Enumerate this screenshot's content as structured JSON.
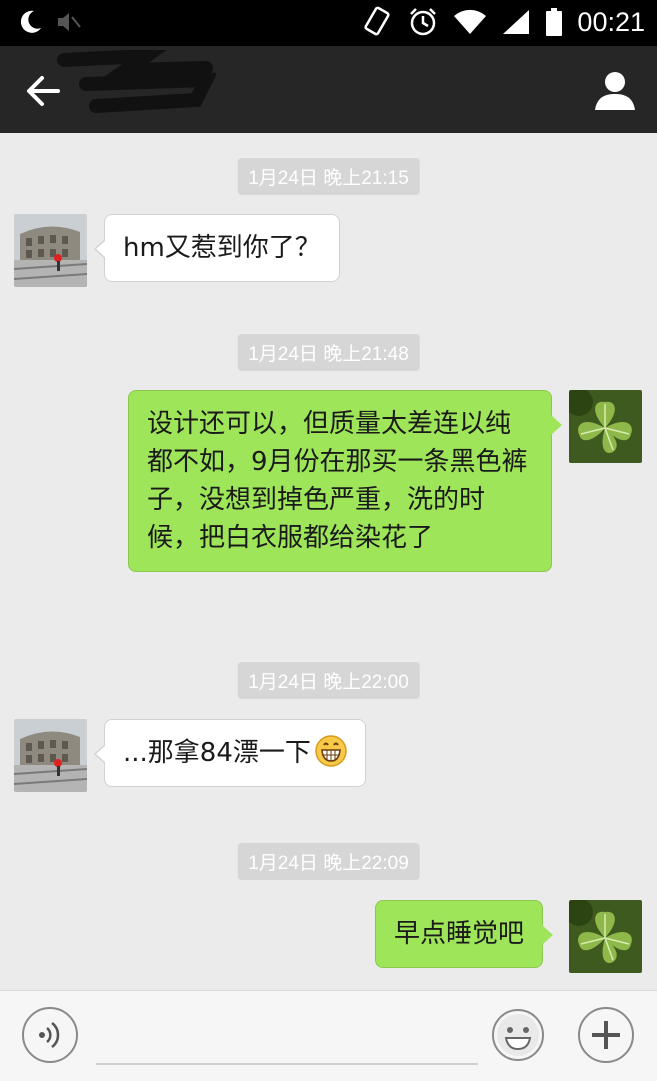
{
  "status_bar": {
    "time": "00:21",
    "icons": [
      "moon-icon",
      "mute-icon",
      "screen-rotation-icon",
      "alarm-icon",
      "wifi-icon",
      "signal-icon",
      "battery-icon"
    ]
  },
  "header": {
    "back_icon": "arrow-left-icon",
    "title": "",
    "profile_icon": "person-icon"
  },
  "messages": [
    {
      "timestamp": "1月24日 晚上21:15",
      "side": "left",
      "text": "hm又惹到你了？"
    },
    {
      "timestamp": "1月24日 晚上21:48",
      "side": "right",
      "text": "设计还可以，但质量太差连以纯都不如，9月份在那买一条黑色裤子，没想到掉色严重，洗的时候，把白衣服都给染花了"
    },
    {
      "timestamp": "1月24日 晚上22:00",
      "side": "left",
      "text": "...那拿84漂一下",
      "emoji": "grinning-face-emoji"
    },
    {
      "timestamp": "1月24日 晚上22:09",
      "side": "right",
      "text": "早点睡觉吧"
    }
  ],
  "input_bar": {
    "voice_icon": "voice-icon",
    "placeholder": "",
    "emoji_icon": "smiley-icon",
    "plus_icon": "plus-icon"
  },
  "colors": {
    "chat_background": "#ebebeb",
    "header_background": "#262626",
    "sent_bubble": "#9ee55a",
    "received_bubble": "#ffffff",
    "timestamp_chip": "#d6d6d6"
  }
}
